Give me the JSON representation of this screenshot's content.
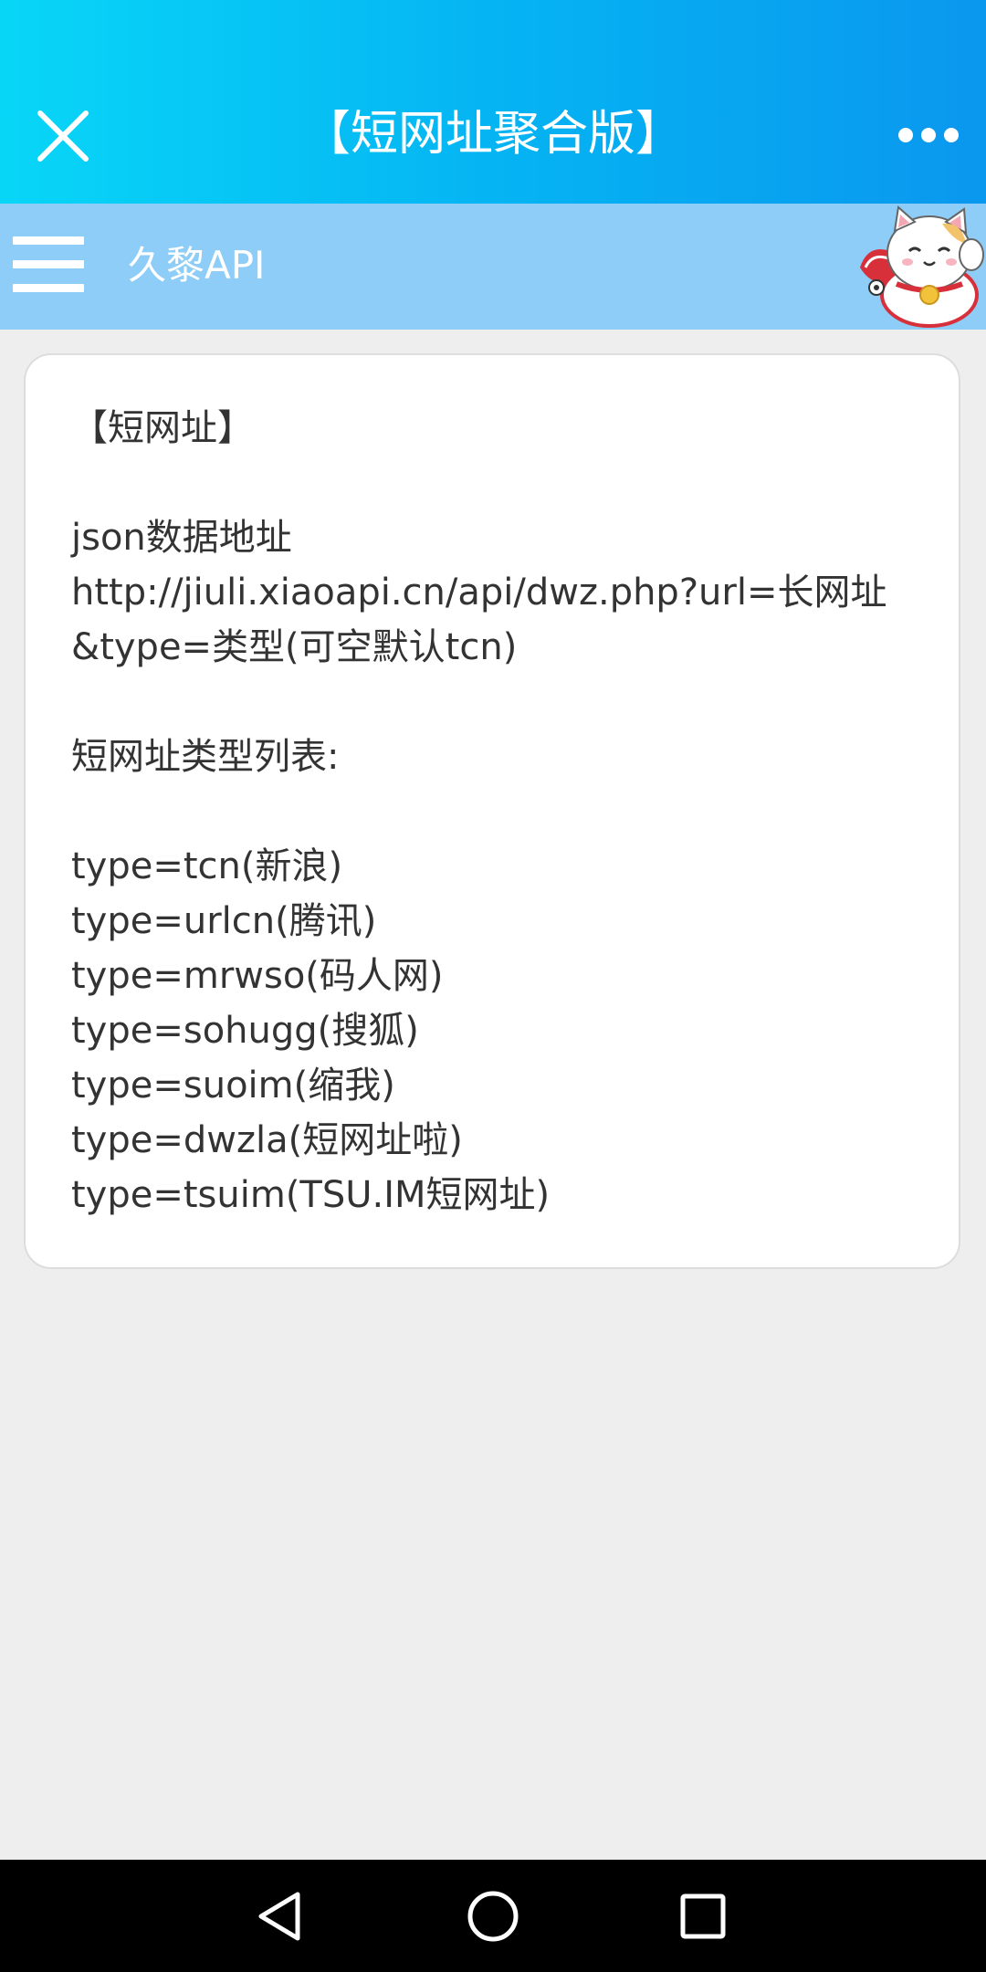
{
  "titlebar": {
    "title": "【短网址聚合版】",
    "close_icon": "close-icon",
    "more_icon": "more-dots-icon",
    "gradient": [
      "#08d6f7",
      "#0a97ee"
    ]
  },
  "subheader": {
    "brand": "久黎API",
    "menu_icon": "hamburger-menu-icon",
    "mascot_icon": "lucky-cat-icon",
    "background": "#8dcdf8"
  },
  "content": {
    "lines": [
      "【短网址】",
      "",
      "json数据地址",
      "http://jiuli.xiaoapi.cn/api/dwz.php?url=长网址",
      "&type=类型(可空默认tcn)",
      "",
      "短网址类型列表:",
      "",
      "type=tcn(新浪)",
      "type=urlcn(腾讯)",
      "type=mrwso(码人网)",
      "type=sohugg(搜狐)",
      "type=suoim(缩我)",
      "type=dwzla(短网址啦)",
      "type=tsuim(TSU.IM短网址)"
    ]
  },
  "navbar": {
    "back_icon": "back-triangle-icon",
    "home_icon": "home-circle-icon",
    "recents_icon": "recents-square-icon"
  }
}
